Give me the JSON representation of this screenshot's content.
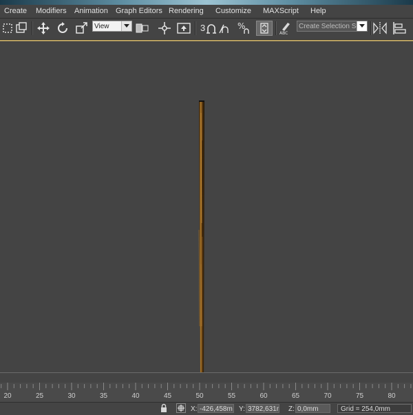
{
  "menu": {
    "items": [
      "Create",
      "Modifiers",
      "Animation",
      "Graph Editors",
      "Rendering",
      "Customize",
      "MAXScript",
      "Help"
    ]
  },
  "toolbar": {
    "ref_coord_value": "View",
    "snap_label": "3",
    "named_selection_placeholder": "Create Selection Se",
    "icons": [
      "select-region-icon",
      "window-crossing-icon",
      "move-icon",
      "rotate-icon",
      "scale-icon",
      "pivot-icon",
      "manipulate-icon",
      "keyboard-shortcut-icon",
      "snap-toggle-icon",
      "angle-snap-icon",
      "percent-snap-icon",
      "spinner-snap-icon",
      "edit-named-selection-icon",
      "mirror-icon",
      "align-icon"
    ]
  },
  "timeline": {
    "tick_labels": [
      "20",
      "25",
      "30",
      "35",
      "40",
      "45",
      "50",
      "55",
      "60",
      "65",
      "70",
      "75",
      "80"
    ]
  },
  "status": {
    "x_label": "X:",
    "x_value": "-426,458m",
    "y_label": "Y:",
    "y_value": "3782,631m",
    "z_label": "Z:",
    "z_value": "0,0mm",
    "grid_text": "Grid = 254,0mm"
  },
  "colors": {
    "viewport_bg": "#444444",
    "viewport_border": "#b8a060",
    "object_wood": "#b07a2a"
  }
}
